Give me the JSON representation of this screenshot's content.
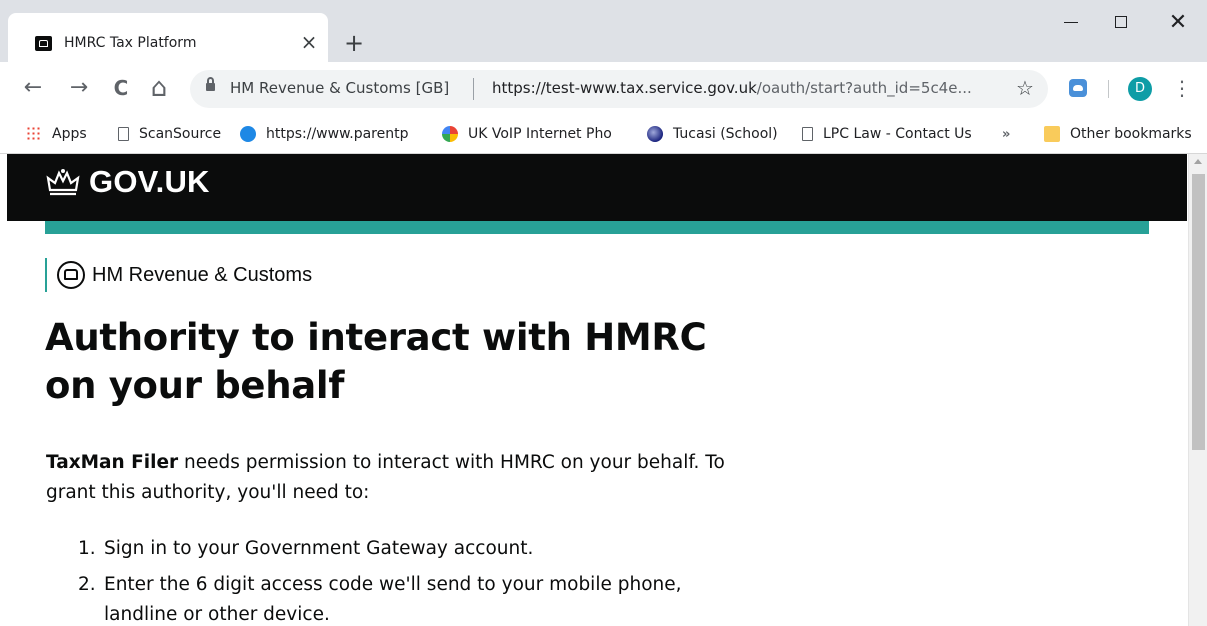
{
  "browser": {
    "tab": {
      "title": "HMRC Tax Platform",
      "close_glyph": "×"
    },
    "new_tab_glyph": "+",
    "window_controls": {
      "minimize": "–",
      "maximize": "☐",
      "close": "✕"
    },
    "nav": {
      "back": "←",
      "forward": "→",
      "reload": "C",
      "home": "⌂"
    },
    "omnibox": {
      "ev_label": "HM Revenue & Customs [GB]",
      "url_host": "https://test-www.tax.service.gov.uk",
      "url_path": "/oauth/start?auth_id=5c4e...",
      "star": "☆"
    },
    "profile_initial": "D",
    "menu_glyph": "⋮",
    "bookmarks": [
      {
        "label": "Apps",
        "icon": "apps-grid-icon"
      },
      {
        "label": "ScanSource",
        "icon": "page-icon"
      },
      {
        "label": "https://www.parentp",
        "icon": "blue-circle-icon"
      },
      {
        "label": "UK VoIP Internet Pho",
        "icon": "multicolor-icon"
      },
      {
        "label": "Tucasi (School)",
        "icon": "globe-icon"
      },
      {
        "label": "LPC Law - Contact Us",
        "icon": "page-icon"
      }
    ],
    "bookmarks_overflow": "»",
    "other_bookmarks": "Other bookmarks"
  },
  "page": {
    "header": {
      "logo_text": "GOV.UK"
    },
    "organisation": "HM Revenue & Customs",
    "title": "Authority to interact with HMRC on your behalf",
    "intro": {
      "app_name": "TaxMan Filer",
      "text": " needs permission to interact with HMRC on your behalf. To grant this authority, you'll need to:"
    },
    "steps": [
      {
        "num": "1.",
        "text": "Sign in to your Government Gateway account."
      },
      {
        "num": "2.",
        "text": "Enter the 6 digit access code we'll send to your mobile phone, landline or other device."
      }
    ]
  },
  "colors": {
    "gov_black": "#0b0c0c",
    "gov_teal": "#28a197",
    "avatar": "#0e9da6"
  }
}
